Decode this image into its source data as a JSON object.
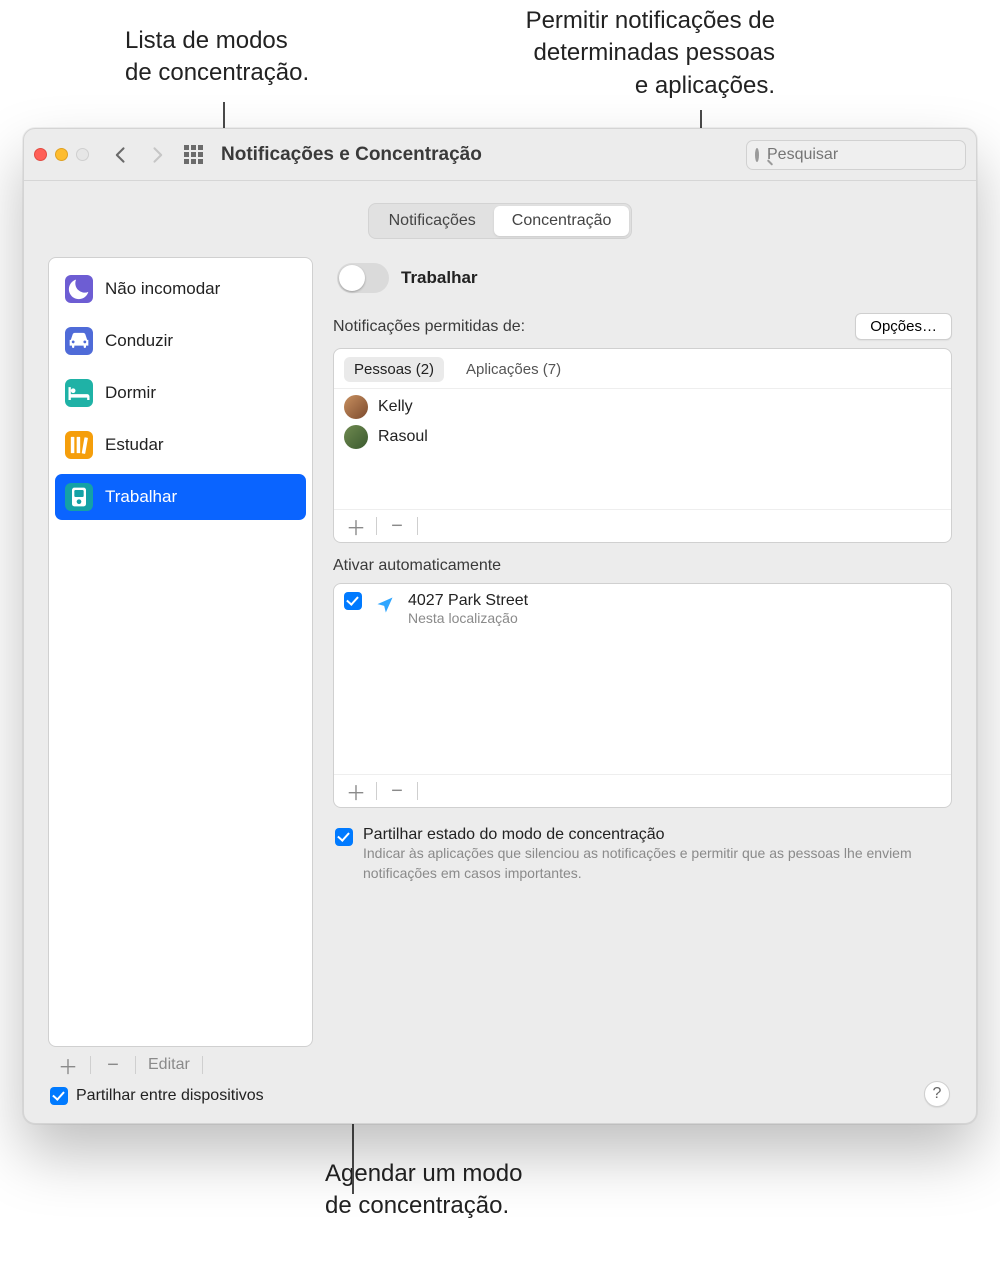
{
  "callouts": {
    "modes_list": "Lista de modos\nde concentração.",
    "allow_notifications": "Permitir notificações de\ndeterminadas pessoas\ne aplicações.",
    "schedule": "Agendar um modo\nde concentração."
  },
  "window": {
    "title": "Notificações e Concentração",
    "search_placeholder": "Pesquisar"
  },
  "tabs": {
    "notifications": "Notificações",
    "focus": "Concentração"
  },
  "sidebar": {
    "items": [
      {
        "label": "Não incomodar"
      },
      {
        "label": "Conduzir"
      },
      {
        "label": "Dormir"
      },
      {
        "label": "Estudar"
      },
      {
        "label": "Trabalhar"
      }
    ],
    "edit": "Editar",
    "share_across": "Partilhar entre dispositivos"
  },
  "detail": {
    "mode_title": "Trabalhar",
    "allowed_from_label": "Notificações permitidas de:",
    "options_label": "Opções…",
    "people_tab": "Pessoas (2)",
    "apps_tab": "Aplicações (7)",
    "people": [
      {
        "name": "Kelly"
      },
      {
        "name": "Rasoul"
      }
    ],
    "auto_on_label": "Ativar automaticamente",
    "auto_items": [
      {
        "title": "4027 Park Street",
        "subtitle": "Nesta localização"
      }
    ],
    "share_status": {
      "title": "Partilhar estado do modo de concentração",
      "subtitle": "Indicar às aplicações que silenciou as notificações e permitir que as pessoas lhe enviem notificações em casos importantes."
    }
  }
}
